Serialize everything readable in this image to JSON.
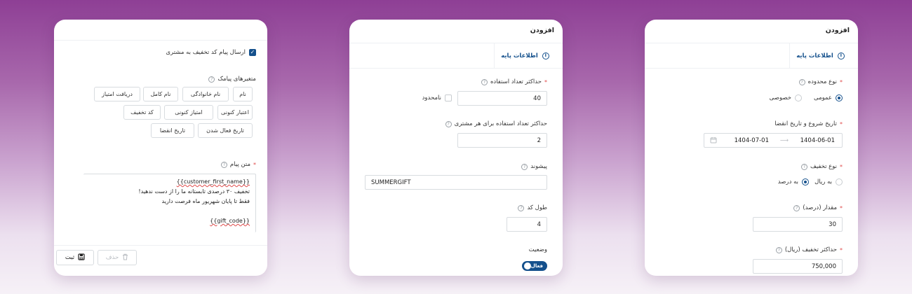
{
  "colors": {
    "accent": "#14508c",
    "required": "#e04b4b"
  },
  "left": {
    "send_checkbox_label": "ارسال پیام کد تخفیف به مشتری",
    "variables_label": "متغیرهای پیامک",
    "variable_chips": [
      "نام",
      "نام خانوادگی",
      "نام کامل",
      "دریافت امتیاز",
      "اعتبار کنونی",
      "امتیاز کنونی",
      "کد تخفیف",
      "تاریخ فعال شدن",
      "تاریخ انقضا"
    ],
    "message_label": "متن پیام",
    "message_lines": [
      "{{customer_first_name}}",
      "تخفیف ۳۰ درصدی تابستانه ما را از دست ندهید!",
      "فقط تا پایان شهریور ماه فرصت دارید",
      "",
      "{{gift_code}}"
    ],
    "save_label": "ثبت",
    "delete_label": "حذف"
  },
  "mid": {
    "title": "افزودن",
    "tab_label": "اطلاعات پایه",
    "max_usage_label": "حداکثر تعداد استفاده",
    "max_usage_value": "40",
    "unlimited_label": "نامحدود",
    "max_per_customer_label": "حداکثر تعداد استفاده برای هر مشتری",
    "max_per_customer_value": "2",
    "prefix_label": "پیشوند",
    "prefix_value": "SUMMERGIFT",
    "code_length_label": "طول کد",
    "code_length_value": "4",
    "status_label": "وضعیت",
    "status_toggle_label": "فعال"
  },
  "right": {
    "title": "افزودن",
    "tab_label": "اطلاعات پایه",
    "scope_label": "نوع محدوده",
    "scope_public": "عمومی",
    "scope_private": "خصوصی",
    "date_label": "تاریخ شروع و تاریخ انقضا",
    "date_start": "1404-06-01",
    "date_end": "1404-07-01",
    "discount_type_label": "نوع تخفیف",
    "discount_percent": "به درصد",
    "discount_rial": "به ریال",
    "amount_label": "مقدار (درصد)",
    "amount_value": "30",
    "max_discount_label": "حداکثر تخفیف (ریال)",
    "max_discount_value": "750,000"
  }
}
